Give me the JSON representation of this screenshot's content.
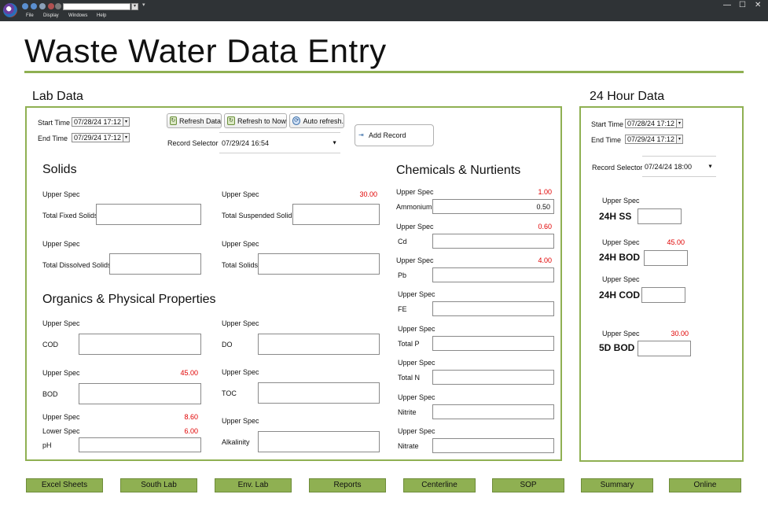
{
  "window": {
    "menu": [
      "File",
      "Display",
      "Windows",
      "Help"
    ],
    "controls": {
      "minimize": "—",
      "maximize": "☐",
      "close": "✕"
    }
  },
  "page_title": "Waste Water Data Entry",
  "lab": {
    "title": "Lab Data",
    "start_label": "Start Time",
    "start_value": "07/28/24 17:12",
    "end_label": "End Time",
    "end_value": "07/29/24 17:12",
    "refresh_data": "Refresh Data",
    "refresh_now": "Refresh to  Now",
    "auto_refresh": "Auto refresh.",
    "add_record": "Add Record",
    "record_selector_label": "Record Selector",
    "record_selector_value": "07/29/24 16:54",
    "solids": {
      "heading": "Solids",
      "upper_spec_1": "Upper Spec",
      "upper_spec_2": "Upper Spec",
      "upper_spec_2_value": "30.00",
      "upper_spec_3": "Upper Spec",
      "upper_spec_4": "Upper Spec",
      "total_fixed": "Total Fixed Solids",
      "total_suspended": "Total Suspended Solids",
      "total_dissolved": "Total Dissolved Solids",
      "total_solids": "Total Solids"
    },
    "organics": {
      "heading": "Organics & Physical Properties",
      "upper_spec_cod": "Upper Spec",
      "cod": "COD",
      "upper_spec_do": "Upper Spec",
      "do": "DO",
      "upper_spec_bod": "Upper Spec",
      "upper_spec_bod_value": "45.00",
      "bod": "BOD",
      "upper_spec_toc": "Upper Spec",
      "toc": "TOC",
      "upper_spec_ph": "Upper Spec",
      "upper_spec_ph_value": "8.60",
      "lower_spec_ph": "Lower Spec",
      "lower_spec_ph_value": "6.00",
      "ph": "pH",
      "upper_spec_alk": "Upper Spec",
      "alkalinity": "Alkalinity"
    },
    "chemicals": {
      "heading": "Chemicals & Nurtients",
      "upper_spec_label": "Upper Spec",
      "items": [
        {
          "name": "Ammonium",
          "upper_spec": "1.00",
          "value": "0.50"
        },
        {
          "name": "Cd",
          "upper_spec": "0.60",
          "value": ""
        },
        {
          "name": "Pb",
          "upper_spec": "4.00",
          "value": ""
        },
        {
          "name": "FE",
          "upper_spec": "",
          "value": ""
        },
        {
          "name": "Total P",
          "upper_spec": "",
          "value": ""
        },
        {
          "name": "Total N",
          "upper_spec": "",
          "value": ""
        },
        {
          "name": "Nitrite",
          "upper_spec": "",
          "value": ""
        },
        {
          "name": "Nitrate",
          "upper_spec": "",
          "value": ""
        }
      ]
    }
  },
  "hour24": {
    "title": "24 Hour Data",
    "start_label": "Start Time",
    "start_value": "07/28/24 17:12",
    "end_label": "End Time",
    "end_value": "07/29/24 17:12",
    "record_selector_label": "Record Selector",
    "record_selector_value": "07/24/24 18:00",
    "upper_spec_label": "Upper Spec",
    "items": [
      {
        "name": "24H SS",
        "upper_spec": ""
      },
      {
        "name": "24H BOD",
        "upper_spec": "45.00"
      },
      {
        "name": "24H COD",
        "upper_spec": ""
      },
      {
        "name": "5D BOD",
        "upper_spec": "30.00"
      }
    ]
  },
  "nav": [
    "Excel Sheets",
    "South Lab",
    "Env. Lab",
    "Reports",
    "Centerline",
    "SOP",
    "Summary",
    "Online"
  ],
  "colors": {
    "accent_green": "#8fb052",
    "spec_red": "#e00000",
    "titlebar": "#2f3336"
  }
}
